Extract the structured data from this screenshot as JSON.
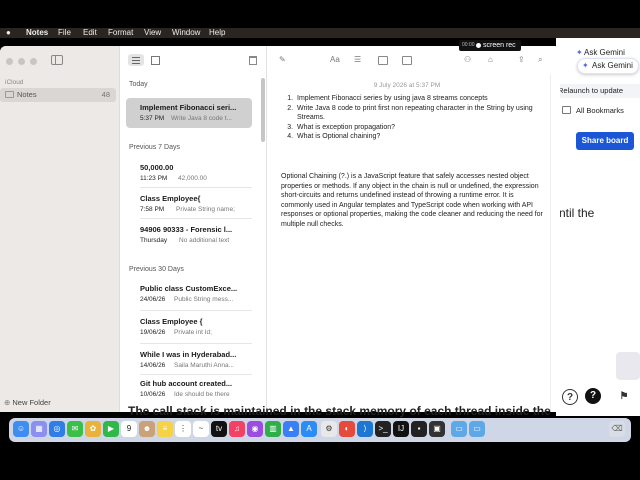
{
  "menubar": {
    "app": "Notes",
    "items": [
      "File",
      "Edit",
      "Format",
      "View",
      "Window",
      "Help"
    ]
  },
  "screen_recorder": {
    "timer": "00:00",
    "label": "screen rec"
  },
  "browser": {
    "ask_gemini_1": "Ask Gemini",
    "ask_gemini_2": "Ask Gemini",
    "relaunch": "Relaunch to update",
    "all_bookmarks": "All Bookmarks",
    "share_board": "Share board",
    "body_fragment": "ntil the",
    "help_icon": "?"
  },
  "sidebar": {
    "account": "iCloud",
    "folder": {
      "label": "Notes",
      "count": "48"
    },
    "new_folder": "New Folder"
  },
  "list": {
    "sections": [
      "Today",
      "Previous 7 Days",
      "Previous 30 Days"
    ],
    "items": [
      {
        "title": "Implement Fibonacci seri...",
        "date": "5:37 PM",
        "preview": "Write Java 8 code t..."
      },
      {
        "title": "50,000.00",
        "date": "11:23 PM",
        "preview": "42,000.00"
      },
      {
        "title": "Class Employee{",
        "date": "7:58 PM",
        "preview": "Private String name;"
      },
      {
        "title": "94906 90333 - Forensic l...",
        "date": "Thursday",
        "preview": "No additional text"
      },
      {
        "title": "Public class CustomExce...",
        "date": "24/06/26",
        "preview": "Public String mess..."
      },
      {
        "title": "Class Employee {",
        "date": "19/06/26",
        "preview": "Private int Id;"
      },
      {
        "title": "While I was in Hyderabad...",
        "date": "14/06/26",
        "preview": "Saila Maruthi Anna..."
      },
      {
        "title": "Git hub account created...",
        "date": "10/06/26",
        "preview": "Ide should be there"
      }
    ]
  },
  "editor": {
    "date": "9 July 2026 at 5:37 PM",
    "list": [
      "Implement Fibonacci series by using java 8 streams concepts",
      "Write Java 8 code to print first non repeating character in the String by using Streams.",
      "What is exception propagation?",
      "What is Optional chaining?"
    ],
    "paragraph": "Optional Chaining (?.) is a JavaScript feature that safely accesses nested object properties or methods. If any object in the chain is null or undefined, the expression short-circuits and returns undefined instead of throwing a runtime error. It is commonly used in Angular templates and TypeScript code when working with API responses or optional properties, making the code cleaner and reducing the need for multiple null checks."
  },
  "background_text": "The call stack is maintained in the stack memory of each thread inside the",
  "dock": {
    "calendar_day": "9",
    "icons": [
      "finder-icon",
      "launchpad-icon",
      "safari-icon",
      "messages-icon",
      "photos-icon",
      "facetime-icon",
      "calendar-icon",
      "contacts-icon",
      "notes-icon",
      "reminders-icon",
      "tv-icon",
      "music-icon",
      "podcasts-icon",
      "numbers-icon",
      "keynote-icon",
      "app-store-icon",
      "settings-icon",
      "chrome-icon",
      "vscode-icon",
      "terminal-icon",
      "intellij-icon",
      "terminal2-icon",
      "preview-icon",
      "folder-icon",
      "downloads-icon",
      "trash-icon"
    ]
  }
}
